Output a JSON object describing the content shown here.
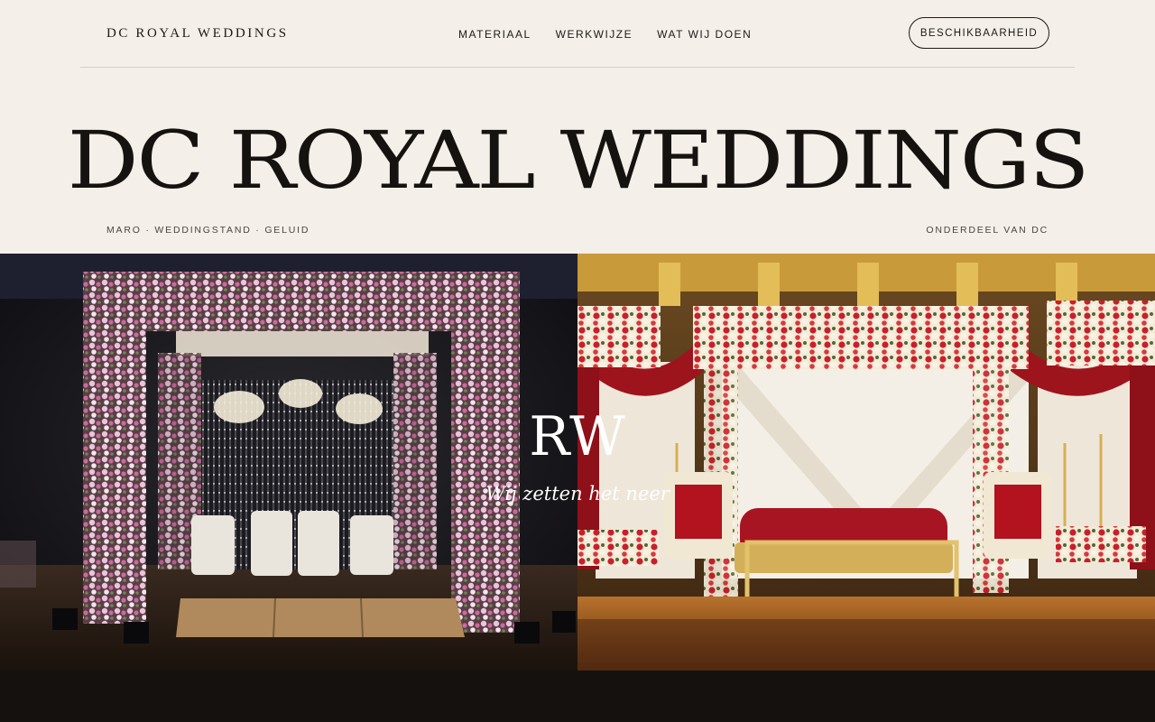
{
  "nav": {
    "brand": "DC ROYAL WEDDINGS",
    "links": [
      "MATERIAAL",
      "WERKWIJZE",
      "WAT WIJ DOEN"
    ],
    "cta": "BESCHIKBAARHEID"
  },
  "hero": {
    "title": "DC ROYAL WEDDINGS",
    "tagline_left": "MARO · WEDDINGSTAND · GELUID",
    "tagline_right": "ONDERDEEL VAN DC"
  },
  "showcase": {
    "monogram": "RW",
    "slogan": "Wij zetten het neer"
  },
  "colors": {
    "background": "#f4efe9",
    "ink": "#1a1714",
    "footer": "#14110e"
  }
}
